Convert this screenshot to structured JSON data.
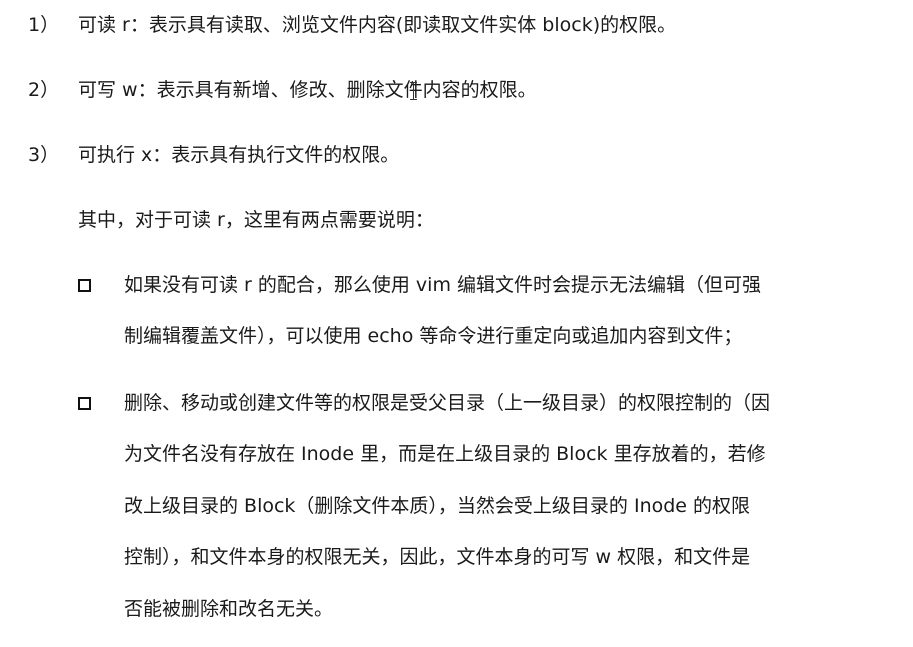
{
  "items": [
    {
      "number": "1）",
      "text": "可读 r：表示具有读取、浏览文件内容(即读取文件实体 block)的权限。"
    },
    {
      "number": "2）",
      "text": "可写 w：表示具有新增、修改、删除文件内容的权限。"
    },
    {
      "number": "3）",
      "text": "可执行 x：表示具有执行文件的权限。"
    }
  ],
  "intro": "其中，对于可读 r，这里有两点需要说明：",
  "bullets": [
    {
      "lines": [
        "如果没有可读 r 的配合，那么使用 vim 编辑文件时会提示无法编辑（但可强",
        "制编辑覆盖文件），可以使用 echo 等命令进行重定向或追加内容到文件；"
      ]
    },
    {
      "lines": [
        "删除、移动或创建文件等的权限是受父目录（上一级目录）的权限控制的（因",
        "为文件名没有存放在 Inode 里，而是在上级目录的 Block 里存放着的，若修",
        "改上级目录的 Block（删除文件本质），当然会受上级目录的 Inode 的权限",
        "控制），和文件本身的权限无关，因此，文件本身的可写 w 权限，和文件是",
        "否能被删除和改名无关。"
      ]
    }
  ]
}
